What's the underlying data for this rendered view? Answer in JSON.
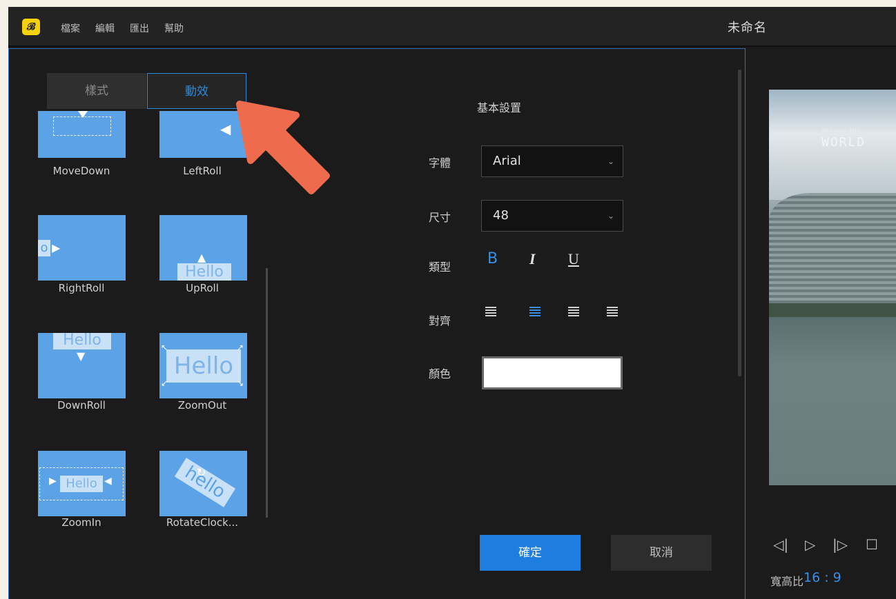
{
  "app": {
    "logo_text": "𝓑",
    "title": "未命名",
    "menu": [
      "檔案",
      "編輯",
      "匯出",
      "幫助"
    ]
  },
  "tabs": [
    {
      "label": "樣式",
      "active": false
    },
    {
      "label": "動效",
      "active": true
    }
  ],
  "effects": [
    {
      "label": "MoveDown",
      "icon": "movedown-thumb"
    },
    {
      "label": "LeftRoll",
      "icon": "leftroll-thumb"
    },
    {
      "label": "RightRoll",
      "icon": "rightroll-thumb",
      "thumb_text": "o"
    },
    {
      "label": "UpRoll",
      "icon": "uproll-thumb",
      "thumb_text": "Hello"
    },
    {
      "label": "DownRoll",
      "icon": "downroll-thumb",
      "thumb_text": "Hello"
    },
    {
      "label": "ZoomOut",
      "icon": "zoomout-thumb",
      "thumb_text": "Hello"
    },
    {
      "label": "ZoomIn",
      "icon": "zoomin-thumb",
      "thumb_text": "Hello"
    },
    {
      "label": "RotateClock...",
      "icon": "rotateclock-thumb",
      "thumb_text": "hello"
    }
  ],
  "settings": {
    "section_title": "基本設置",
    "font_label": "字體",
    "font_value": "Arial",
    "size_label": "尺寸",
    "size_value": "48",
    "type_label": "類型",
    "bold": "B",
    "italic": "I",
    "underline": "U",
    "align_label": "對齊",
    "color_label": "顏色",
    "color_value": "#ffffff"
  },
  "buttons": {
    "ok": "確定",
    "cancel": "取消"
  },
  "preview": {
    "overlay_small": "AROUND THE",
    "overlay_big": "WORLD",
    "ratio_label": "寬高比",
    "ratio_value": "16 : 9"
  },
  "colors": {
    "accent": "#1e7ee0",
    "annotation_arrow": "#ee6c4d",
    "thumb": "#5ba2e6"
  }
}
